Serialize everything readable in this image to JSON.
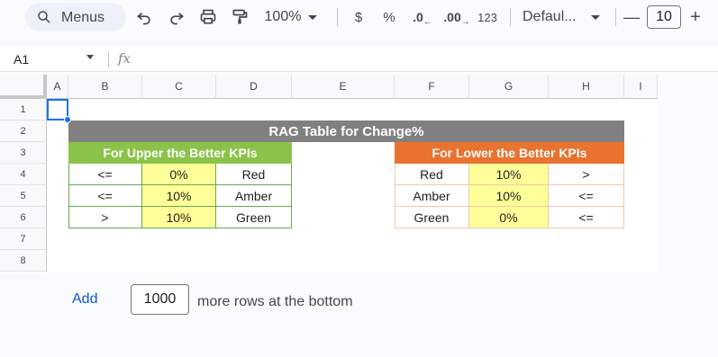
{
  "toolbar": {
    "menus_label": "Menus",
    "zoom": "100%",
    "currency": "$",
    "percent": "%",
    "dec_decrease": ".0",
    "dec_increase": ".00",
    "format_123": "123",
    "font": "Defaul...",
    "font_size": "10",
    "minus": "—",
    "plus": "+"
  },
  "formula_bar": {
    "cell_ref": "A1",
    "fx": "fx"
  },
  "columns": [
    "A",
    "B",
    "C",
    "D",
    "E",
    "F",
    "G",
    "H",
    "I"
  ],
  "rows": [
    "1",
    "2",
    "3",
    "4",
    "5",
    "6",
    "7",
    "8"
  ],
  "sheet": {
    "title": "RAG Table for Change%",
    "upper": {
      "header": "For Upper the Better KPIs",
      "rows": [
        [
          "<=",
          "0%",
          "Red"
        ],
        [
          "<=",
          "10%",
          "Amber"
        ],
        [
          ">",
          "10%",
          "Green"
        ]
      ]
    },
    "lower": {
      "header": "For Lower the Better KPIs",
      "rows": [
        [
          "Red",
          "10%",
          ">"
        ],
        [
          "Amber",
          "10%",
          "<="
        ],
        [
          "Green",
          "0%",
          "<="
        ]
      ]
    }
  },
  "footer": {
    "add_label": "Add",
    "rows_value": "1000",
    "more_text": "more rows at the bottom"
  },
  "colors": {
    "title_bg": "#808080",
    "green_header": "#8bc34a",
    "orange_header": "#e8732f",
    "highlight": "#ffff99",
    "selection": "#1a73e8"
  }
}
